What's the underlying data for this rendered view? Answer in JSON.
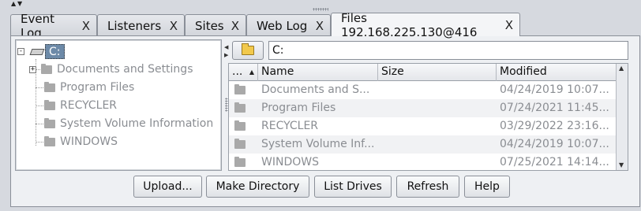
{
  "tabs": [
    {
      "label": "Event Log",
      "close": "X"
    },
    {
      "label": "Listeners",
      "close": "X"
    },
    {
      "label": "Sites",
      "close": "X"
    },
    {
      "label": "Web Log",
      "close": "X"
    },
    {
      "label": "Files 192.168.225.130@416",
      "close": "X",
      "active": true
    }
  ],
  "tree": {
    "root_label": "C:",
    "expander_symbol": "-",
    "child_expander_symbol": "+",
    "items": [
      {
        "label": "Documents and Settings",
        "expandable": true
      },
      {
        "label": "Program Files"
      },
      {
        "label": "RECYCLER"
      },
      {
        "label": "System Volume Information"
      },
      {
        "label": "WINDOWS"
      }
    ]
  },
  "path": {
    "value": "C:"
  },
  "table": {
    "columns": [
      "...",
      "Name",
      "Size",
      "Modified"
    ],
    "sort_indicator": "▲",
    "rows": [
      {
        "name": "Documents and S...",
        "size": "",
        "modified": "04/24/2019 10:07..."
      },
      {
        "name": "Program Files",
        "size": "",
        "modified": "07/24/2021 11:45..."
      },
      {
        "name": "RECYCLER",
        "size": "",
        "modified": "03/29/2022 23:16..."
      },
      {
        "name": "System Volume Inf...",
        "size": "",
        "modified": "04/24/2019 10:07..."
      },
      {
        "name": "WINDOWS",
        "size": "",
        "modified": "07/25/2021 14:14..."
      }
    ]
  },
  "buttons": {
    "upload": "Upload...",
    "make_directory": "Make Directory",
    "list_drives": "List Drives",
    "refresh": "Refresh",
    "help": "Help"
  },
  "colors": {
    "selection": "#6d8aa8",
    "folder_grey": "#a9a9a9",
    "folder_button_yellow": "#f2c94c"
  }
}
